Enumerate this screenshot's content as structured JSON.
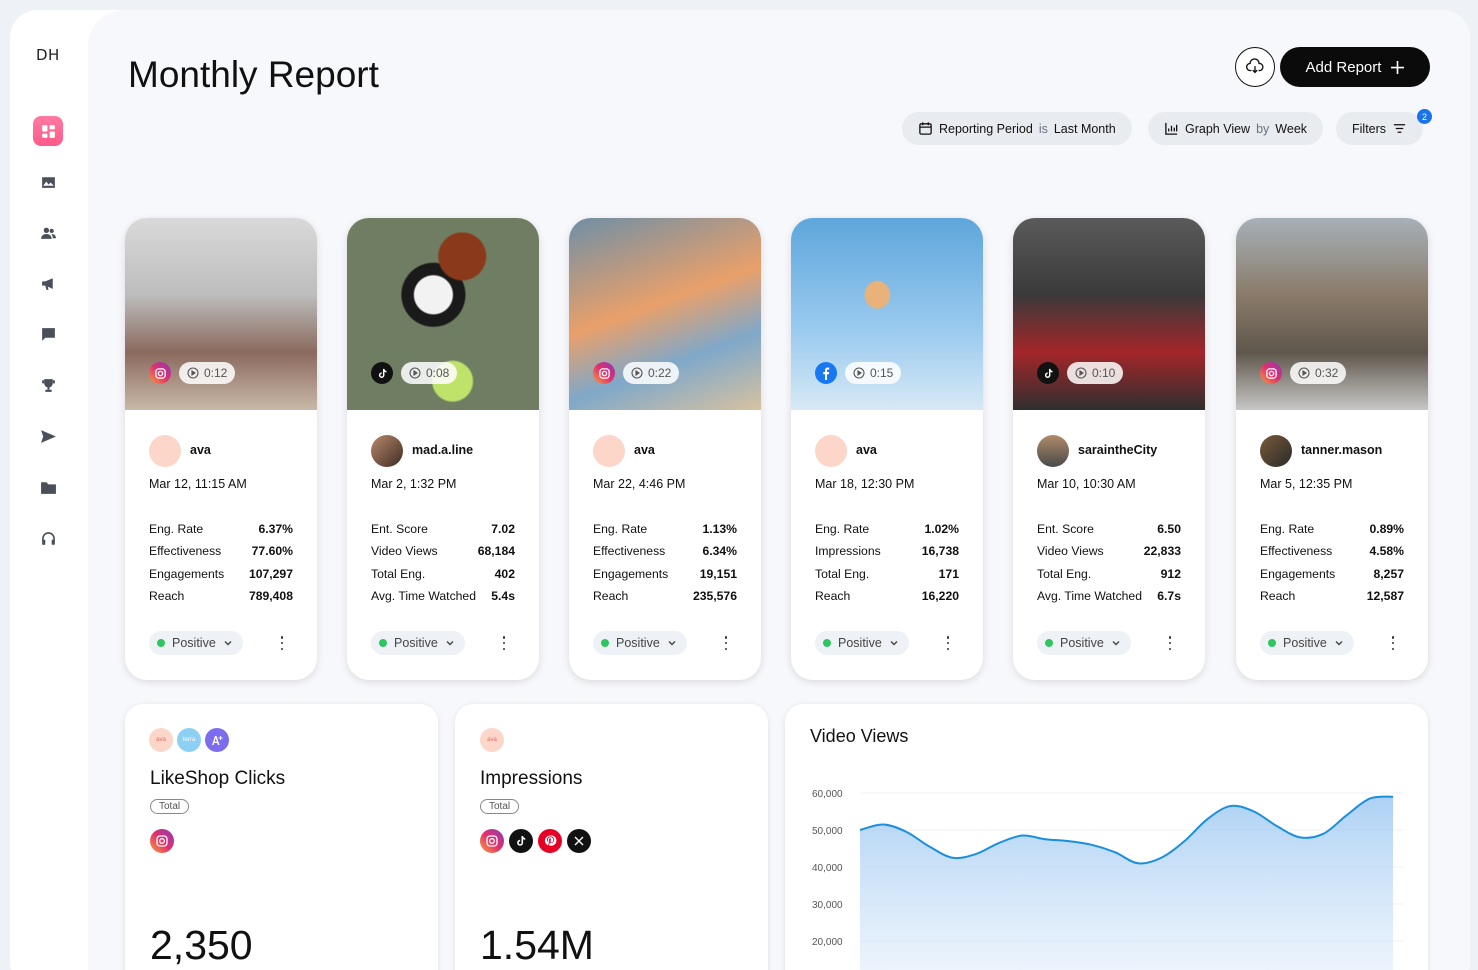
{
  "app": {
    "logo": "DH",
    "title": "Monthly Report"
  },
  "toolbar": {
    "add_label": "Add Report",
    "add_icon": "plus-icon",
    "download_icon": "cloud-download-icon"
  },
  "filters": {
    "period": {
      "label": "Reporting Period",
      "is": "is",
      "value": "Last Month"
    },
    "graph": {
      "label": "Graph View",
      "by": "by",
      "value": "Week"
    },
    "filters": {
      "label": "Filters",
      "badge": "2"
    }
  },
  "cards": [
    {
      "platform": "instagram",
      "duration": "0:12",
      "user": "ava",
      "date": "Mar 12, 11:15 AM",
      "metrics": [
        [
          "Eng. Rate",
          "6.37%"
        ],
        [
          "Effectiveness",
          "77.60%"
        ],
        [
          "Engagements",
          "107,297"
        ],
        [
          "Reach",
          "789,408"
        ]
      ],
      "sentiment": "Positive"
    },
    {
      "platform": "tiktok",
      "duration": "0:08",
      "user": "mad.a.line",
      "date": "Mar 2, 1:32 PM",
      "metrics": [
        [
          "Ent. Score",
          "7.02"
        ],
        [
          "Video Views",
          "68,184"
        ],
        [
          "Total Eng.",
          "402"
        ],
        [
          "Avg. Time Watched",
          "5.4s"
        ]
      ],
      "sentiment": "Positive"
    },
    {
      "platform": "instagram",
      "duration": "0:22",
      "user": "ava",
      "date": "Mar 22, 4:46 PM",
      "metrics": [
        [
          "Eng. Rate",
          "1.13%"
        ],
        [
          "Effectiveness",
          "6.34%"
        ],
        [
          "Engagements",
          "19,151"
        ],
        [
          "Reach",
          "235,576"
        ]
      ],
      "sentiment": "Positive"
    },
    {
      "platform": "facebook",
      "duration": "0:15",
      "user": "ava",
      "date": "Mar 18, 12:30 PM",
      "metrics": [
        [
          "Eng. Rate",
          "1.02%"
        ],
        [
          "Impressions",
          "16,738"
        ],
        [
          "Total Eng.",
          "171"
        ],
        [
          "Reach",
          "16,220"
        ]
      ],
      "sentiment": "Positive"
    },
    {
      "platform": "tiktok",
      "duration": "0:10",
      "user": "saraintheCity",
      "date": "Mar 10, 10:30 AM",
      "metrics": [
        [
          "Ent. Score",
          "6.50"
        ],
        [
          "Video Views",
          "22,833"
        ],
        [
          "Total Eng.",
          "912"
        ],
        [
          "Avg. Time Watched",
          "6.7s"
        ]
      ],
      "sentiment": "Positive"
    },
    {
      "platform": "instagram",
      "duration": "0:32",
      "user": "tanner.mason",
      "date": "Mar 5, 12:35 PM",
      "metrics": [
        [
          "Eng. Rate",
          "0.89%"
        ],
        [
          "Effectiveness",
          "4.58%"
        ],
        [
          "Engagements",
          "8,257"
        ],
        [
          "Reach",
          "12,587"
        ]
      ],
      "sentiment": "Positive"
    }
  ],
  "panels": {
    "likeshop": {
      "title": "LikeShop Clicks",
      "tag": "Total",
      "value": "2,350",
      "avatars": [
        "ava",
        "terra"
      ]
    },
    "impressions": {
      "title": "Impressions",
      "tag": "Total",
      "value": "1.54M",
      "avatars": [
        "ava"
      ]
    },
    "video": {
      "title": "Video Views"
    }
  },
  "chart_data": {
    "type": "area",
    "title": "Video Views",
    "y_ticks": [
      "60,000",
      "50,000",
      "40,000",
      "30,000",
      "20,000"
    ],
    "ylim": [
      20000,
      60000
    ],
    "series": [
      {
        "values": [
          50000,
          51500,
          49500,
          45500,
          42500,
          43500,
          46500,
          48500,
          47500,
          47000,
          46000,
          44000,
          41000,
          42500,
          47000,
          53000,
          56500,
          55000,
          51000,
          48000,
          49000,
          54000,
          58500,
          59000
        ]
      }
    ],
    "grid": true,
    "color": "#1a8fe0"
  }
}
